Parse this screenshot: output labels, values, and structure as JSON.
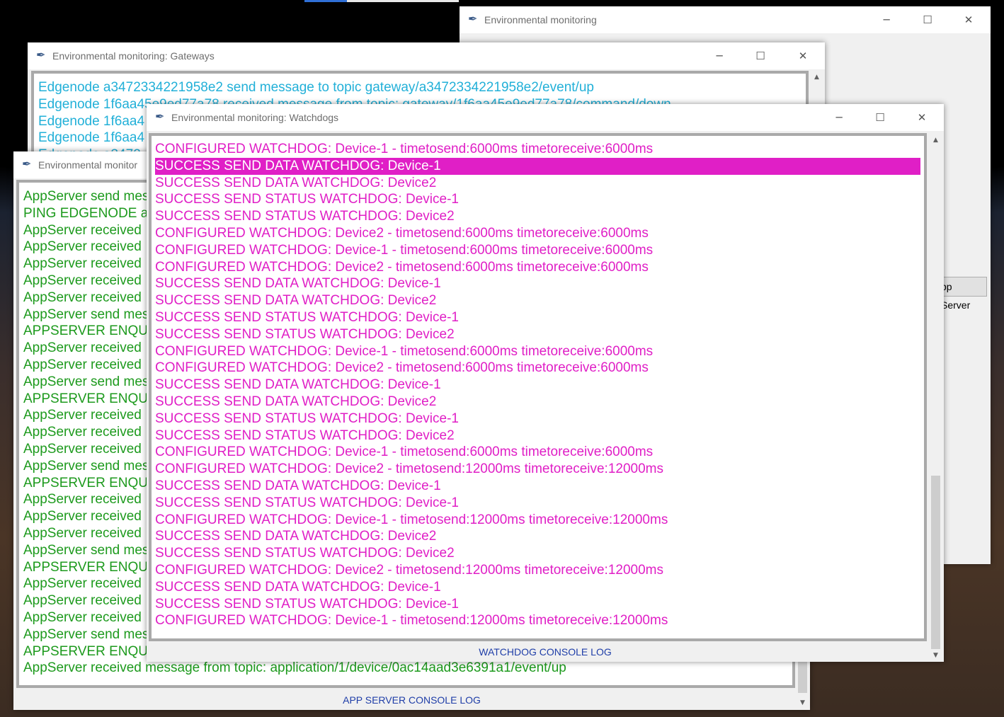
{
  "main_window": {
    "title": "Environmental monitoring",
    "button_partial": "pp Server",
    "controls": {
      "minimize": "─",
      "maximize": "☐",
      "close": "✕"
    }
  },
  "gateways_window": {
    "title": "Environmental monitoring: Gateways",
    "color": "#22b0d8",
    "lines": [
      "Edgenode a3472334221958e2 send message to topic gateway/a3472334221958e2/event/up",
      "Edgenode 1f6aa45e9ed77a78 received message from topic: gateway/1f6aa45e9ed77a78/command/down",
      "Edgenode 1f6aa4",
      "Edgenode 1f6aa4",
      "Edgenode a3472"
    ]
  },
  "appserver_window": {
    "title": "Environmental monitor",
    "color": "#1d9a1d",
    "footer": "APP SERVER CONSOLE LOG",
    "lines": [
      "AppServer send mes",
      "PING EDGENODE a",
      "AppServer received",
      "AppServer received",
      "AppServer received",
      "AppServer received",
      "AppServer received",
      "AppServer send mes",
      "APPSERVER ENQU",
      "AppServer received",
      "AppServer received",
      "AppServer send mes",
      "APPSERVER ENQU",
      "AppServer received",
      "AppServer received",
      "AppServer received",
      "AppServer send mes",
      "APPSERVER ENQU",
      "AppServer received",
      "AppServer received",
      "AppServer received",
      "AppServer send mes",
      "APPSERVER ENQU",
      "AppServer received",
      "AppServer received",
      "AppServer received",
      "AppServer send mes",
      "APPSERVER ENQU",
      "AppServer received message from topic: application/1/device/0ac14aad3e6391a1/event/up"
    ]
  },
  "watchdog_window": {
    "title": "Environmental monitoring: Watchdogs",
    "color": "#e01fc6",
    "highlight_color": "#e01fc6",
    "selected_index": 1,
    "footer": "WATCHDOG CONSOLE LOG",
    "lines": [
      "CONFIGURED WATCHDOG: Device-1 - timetosend:6000ms timetoreceive:6000ms",
      "SUCCESS SEND DATA WATCHDOG: Device-1",
      "SUCCESS SEND DATA WATCHDOG: Device2",
      "SUCCESS SEND STATUS WATCHDOG: Device-1",
      "SUCCESS SEND STATUS WATCHDOG: Device2",
      "CONFIGURED WATCHDOG: Device2 - timetosend:6000ms timetoreceive:6000ms",
      "CONFIGURED WATCHDOG: Device-1 - timetosend:6000ms timetoreceive:6000ms",
      "CONFIGURED WATCHDOG: Device2 - timetosend:6000ms timetoreceive:6000ms",
      "SUCCESS SEND DATA WATCHDOG: Device-1",
      "SUCCESS SEND DATA WATCHDOG: Device2",
      "SUCCESS SEND STATUS WATCHDOG: Device-1",
      "SUCCESS SEND STATUS WATCHDOG: Device2",
      "CONFIGURED WATCHDOG: Device-1 - timetosend:6000ms timetoreceive:6000ms",
      "CONFIGURED WATCHDOG: Device2 - timetosend:6000ms timetoreceive:6000ms",
      "SUCCESS SEND DATA WATCHDOG: Device-1",
      "SUCCESS SEND DATA WATCHDOG: Device2",
      "SUCCESS SEND STATUS WATCHDOG: Device-1",
      "SUCCESS SEND STATUS WATCHDOG: Device2",
      "CONFIGURED WATCHDOG: Device-1 - timetosend:6000ms timetoreceive:6000ms",
      "CONFIGURED WATCHDOG: Device2 - timetosend:12000ms timetoreceive:12000ms",
      "SUCCESS SEND DATA WATCHDOG: Device-1",
      "SUCCESS SEND STATUS WATCHDOG: Device-1",
      "CONFIGURED WATCHDOG: Device-1 - timetosend:12000ms timetoreceive:12000ms",
      "SUCCESS SEND DATA WATCHDOG: Device2",
      "SUCCESS SEND STATUS WATCHDOG: Device2",
      "CONFIGURED WATCHDOG: Device2 - timetosend:12000ms timetoreceive:12000ms",
      "SUCCESS SEND DATA WATCHDOG: Device-1",
      "SUCCESS SEND STATUS WATCHDOG: Device-1",
      "CONFIGURED WATCHDOG: Device-1 - timetosend:12000ms timetoreceive:12000ms"
    ]
  },
  "icons": {
    "title_icon": "feather-icon",
    "scroll_up": "arrow-up-icon",
    "scroll_down": "arrow-down-icon"
  }
}
